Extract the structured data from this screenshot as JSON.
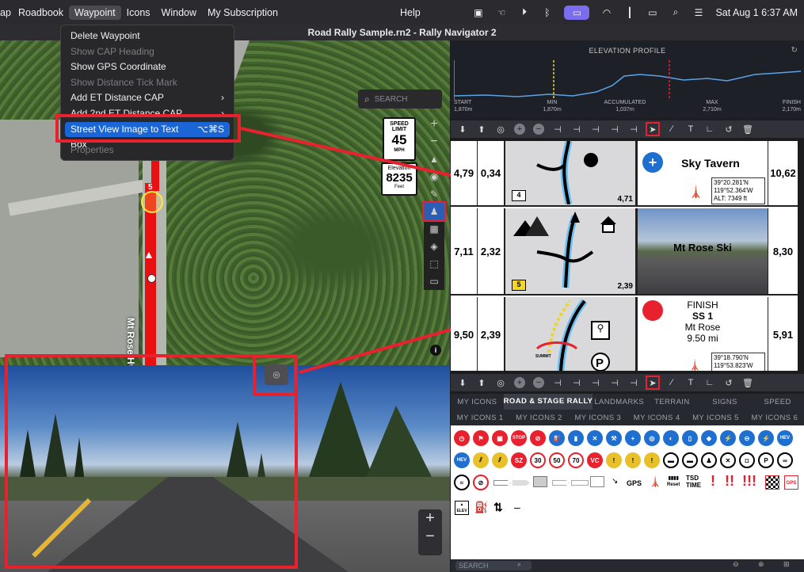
{
  "menubar": {
    "items": [
      "ap",
      "Roadbook",
      "Waypoint",
      "Icons",
      "Window",
      "My Subscription",
      "Help"
    ],
    "clock": "Sat Aug 1  6:37 AM"
  },
  "window": {
    "title": "Road Rally Sample.rn2 - Rally Navigator 2"
  },
  "menu": {
    "items": [
      {
        "label": "Delete Waypoint",
        "enabled": true
      },
      {
        "label": "Show CAP Heading",
        "enabled": false
      },
      {
        "label": "Show GPS Coordinate",
        "enabled": true
      },
      {
        "label": "Show Distance Tick Mark",
        "enabled": false
      },
      {
        "label": "Add ET Distance CAP",
        "enabled": true,
        "submenu": true
      },
      {
        "label": "Add 2nd ET Distance CAP",
        "enabled": true,
        "submenu": true
      },
      {
        "label": "Street View Image to Text Box",
        "enabled": true,
        "shortcut": "⌥⌘S",
        "highlighted": true
      },
      {
        "label": "Properties",
        "enabled": false
      }
    ]
  },
  "map": {
    "search_placeholder": "SEARCH",
    "road_label": "Mt Rose Hwy",
    "waypoint_number": "5",
    "speed_sign": {
      "line1": "SPEED",
      "line2": "LIMIT",
      "value": "45",
      "unit": "MPH"
    },
    "elevation_sign": {
      "label": "Elevation",
      "value": "8235",
      "unit": "Feet"
    }
  },
  "elevation": {
    "title": "ELEVATION PROFILE",
    "stats": [
      {
        "label": "START",
        "value": "1,870m"
      },
      {
        "label": "MIN",
        "value": "1,870m"
      },
      {
        "label": "ACCUMULATED",
        "value": "1,037m"
      },
      {
        "label": "MAX",
        "value": "2,710m"
      },
      {
        "label": "FINISH",
        "value": "2,170m"
      }
    ]
  },
  "roadbook": {
    "rows": [
      {
        "total": "4,79",
        "partial": "0,34",
        "number": "4",
        "dist": "4,71",
        "right": "10,62",
        "note_title": "Sky Tavern",
        "gps1": "39°20.281'N",
        "gps2": "119°52.364'W",
        "alt": "ALT: 7349 ft"
      },
      {
        "total": "7,11",
        "partial": "2,32",
        "number": "5",
        "dist": "2,39",
        "right": "8,30",
        "note_title": "Mt Rose Ski"
      },
      {
        "total": "9,50",
        "partial": "2,39",
        "number": "",
        "right": "5,91",
        "finish": "FINISH",
        "ss": "SS 1",
        "place": "Mt Rose",
        "miles": "9.50 mi",
        "gps1": "39°18.790'N",
        "gps2": "119°53.823'W",
        "summit": "SUMMIT"
      }
    ]
  },
  "library": {
    "tabs1": [
      "MY ICONS",
      "ROAD & STAGE RALLY",
      "LANDMARKS",
      "TERRAIN",
      "SIGNS",
      "SPEED"
    ],
    "tabs2": [
      "MY ICONS 1",
      "MY ICONS 2",
      "MY ICONS 3",
      "MY ICONS 4",
      "MY ICONS 5",
      "MY ICONS 6"
    ],
    "labels": {
      "stop": "STOP",
      "hev": "HEV",
      "sz": "SZ",
      "s30": "30",
      "s50": "50",
      "s70": "70",
      "vc": "VC",
      "p": "P",
      "gps": "GPS",
      "reset": "Reset",
      "tsd": "TSD",
      "time": "TIME",
      "elev": "ELEV",
      "ex": "!",
      "ex2": "!!",
      "ex3": "!!!"
    },
    "search_placeholder": "SEARCH"
  }
}
